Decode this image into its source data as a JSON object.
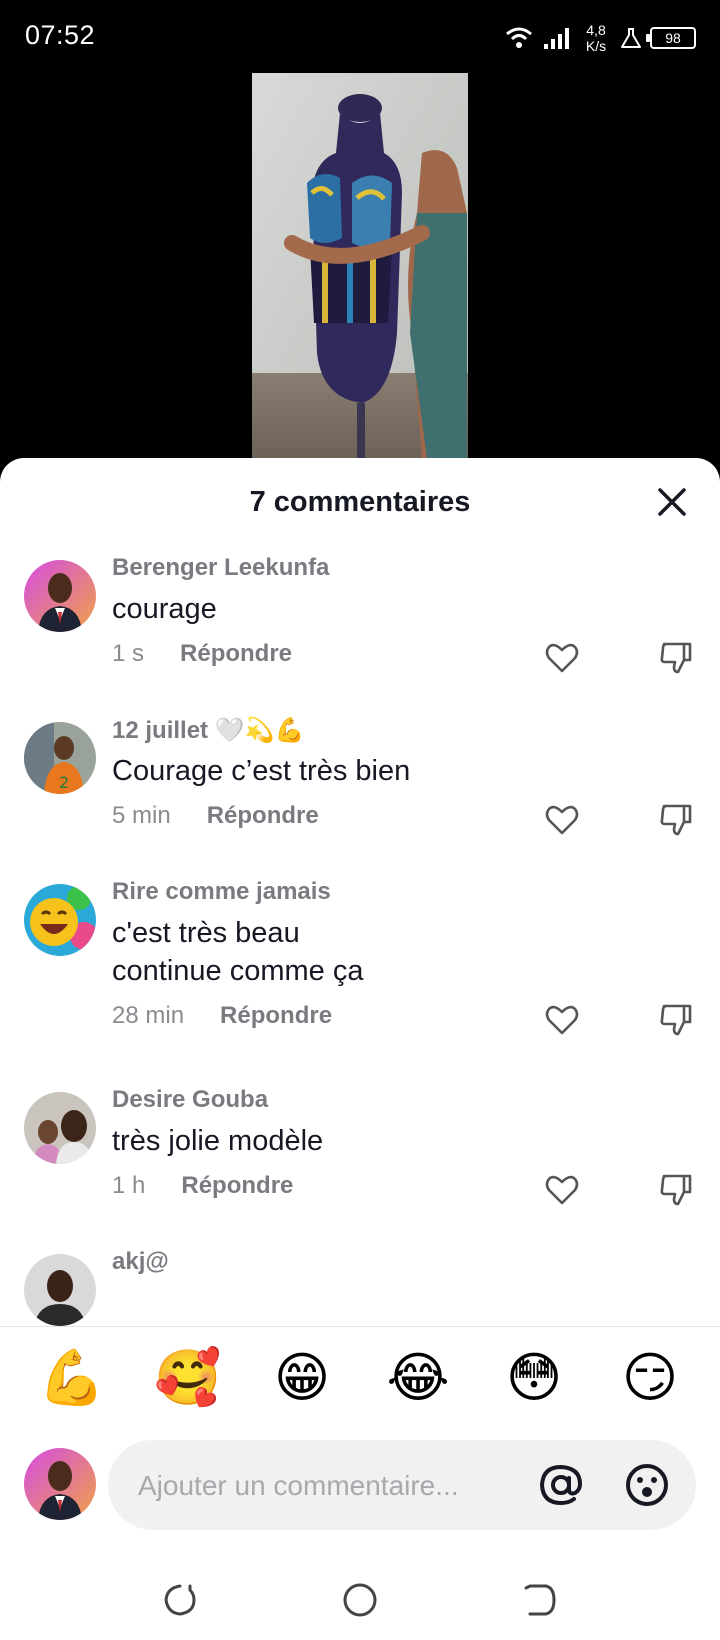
{
  "status": {
    "time": "07:52",
    "net_speed_value": "4,8",
    "net_speed_unit": "K/s",
    "battery": "98"
  },
  "sheet": {
    "title": "7 commentaires"
  },
  "comments": [
    {
      "author": "Berenger Leekunfa",
      "author_emoji": "",
      "text": "courage",
      "time": "1 s",
      "reply": "Répondre"
    },
    {
      "author": "12 juillet",
      "author_emoji": "🤍💫💪",
      "text": "Courage c’est très bien",
      "time": "5 min",
      "reply": "Répondre"
    },
    {
      "author": "Rire comme jamais",
      "author_emoji": "",
      "text": "c'est très beau\ncontinue comme ça",
      "time": "28 min",
      "reply": "Répondre"
    },
    {
      "author": "Desire Gouba",
      "author_emoji": "",
      "text": "très jolie modèle",
      "time": "1 h",
      "reply": "Répondre"
    },
    {
      "author": "akj@",
      "author_emoji": "",
      "text": "",
      "time": "",
      "reply": ""
    }
  ],
  "quick_emojis": [
    "💪",
    "🥰",
    "😁",
    "😂",
    "😳",
    "😏"
  ],
  "input": {
    "placeholder": "Ajouter un commentaire..."
  },
  "colors": {
    "sheet_bg": "#ffffff",
    "input_bg": "#f1f1f2",
    "text_primary": "#161823",
    "text_secondary": "#7a7b80"
  }
}
